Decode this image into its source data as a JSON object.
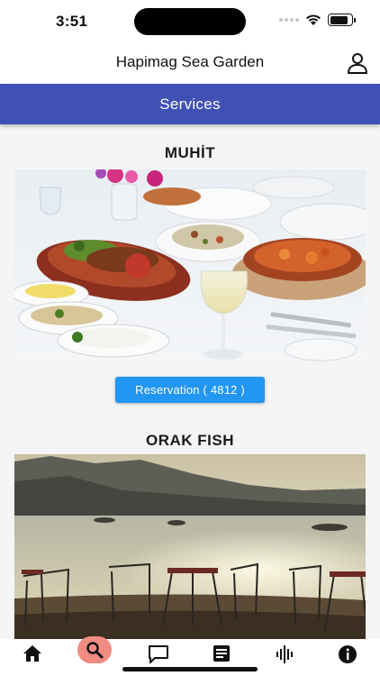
{
  "status_bar": {
    "time": "3:51"
  },
  "header": {
    "title": "Hapimag Sea Garden",
    "profile_icon": "user-icon"
  },
  "section": {
    "title": "Services"
  },
  "services": [
    {
      "name": "MUHİT",
      "reservation_label": "Reservation ( 4812 )",
      "image": "restaurant-dining-table-photo"
    },
    {
      "name": "ORAK FISH",
      "image": "seaside-terrace-sunset-photo"
    }
  ],
  "tab_bar": {
    "items": [
      {
        "icon": "home-icon"
      },
      {
        "icon": "search-icon",
        "active": true
      },
      {
        "icon": "chat-icon"
      },
      {
        "icon": "article-icon"
      },
      {
        "icon": "audio-wave-icon"
      },
      {
        "icon": "info-icon"
      }
    ],
    "active_color": "#f28b82"
  },
  "colors": {
    "section_bar": "#4051b5",
    "button": "#2196f3"
  }
}
